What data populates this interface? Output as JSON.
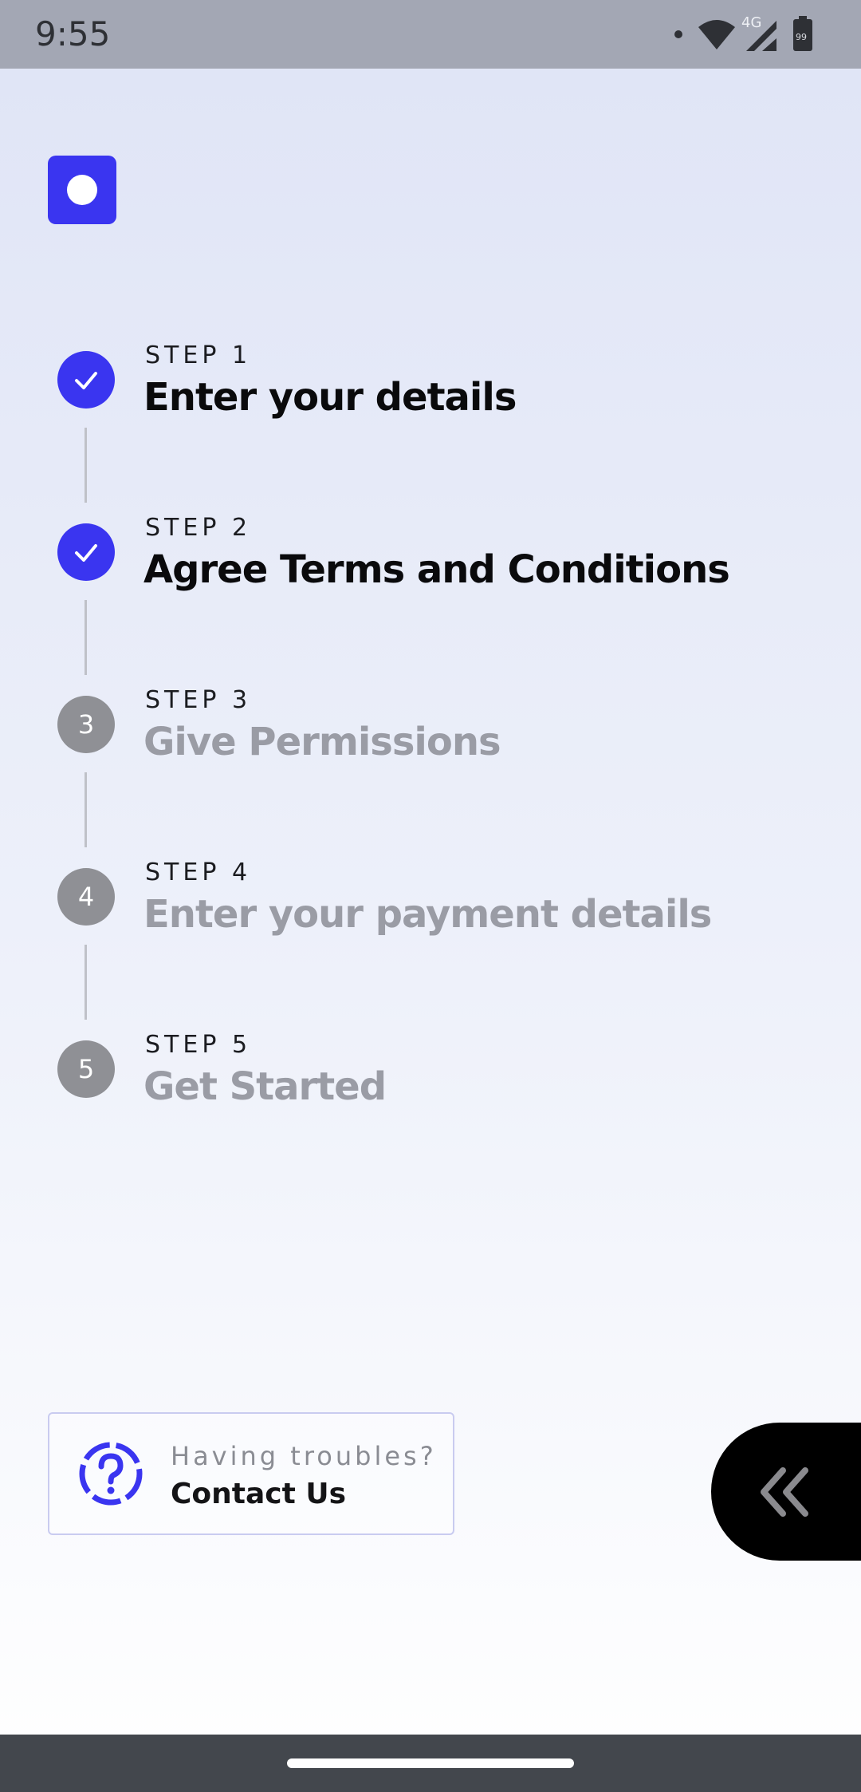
{
  "status_bar": {
    "time": "9:55",
    "network_label": "4G",
    "battery_level": "99",
    "icons": [
      "notification-dot-icon",
      "wifi-icon",
      "cellular-signal-icon",
      "battery-icon"
    ]
  },
  "logo": {
    "icon": "app-logo-icon",
    "accent_color": "#3a35f0"
  },
  "steps": [
    {
      "label": "STEP 1",
      "title": "Enter your details",
      "number": "1",
      "status": "done"
    },
    {
      "label": "STEP 2",
      "title": "Agree Terms and Conditions",
      "number": "2",
      "status": "done"
    },
    {
      "label": "STEP 3",
      "title": "Give Permissions",
      "number": "3",
      "status": "pending"
    },
    {
      "label": "STEP 4",
      "title": "Enter your payment details",
      "number": "4",
      "status": "pending"
    },
    {
      "label": "STEP 5",
      "title": "Get Started",
      "number": "5",
      "status": "pending"
    }
  ],
  "help": {
    "subtitle": "Having troubles?",
    "title": "Contact Us",
    "icon": "help-question-icon"
  },
  "fab": {
    "icon": "double-chevron-left-icon"
  },
  "colors": {
    "accent": "#3a35f0",
    "done_text": "#0a0a0c",
    "pending_text": "#9a9ca5",
    "pending_circle": "#8f9095"
  }
}
